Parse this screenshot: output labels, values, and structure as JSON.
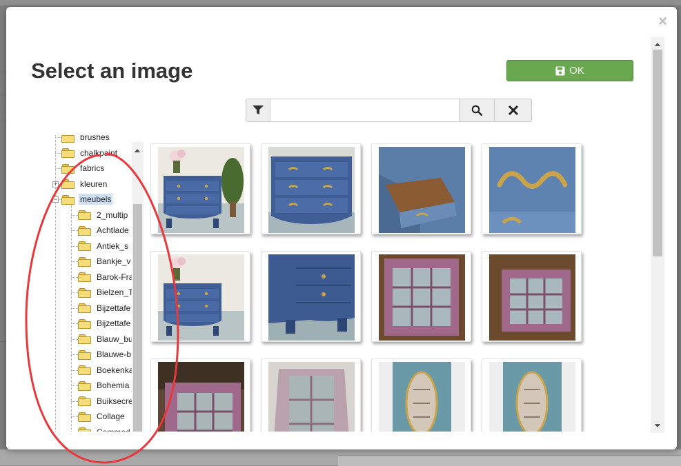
{
  "dialog": {
    "title": "Select an image",
    "close_label": "×",
    "ok_label": "OK",
    "ok_color": "#6aa84f"
  },
  "search": {
    "value": "",
    "placeholder": "",
    "filter_icon": "filter-icon",
    "search_icon": "search-icon",
    "clear_icon": "clear-icon"
  },
  "tree": {
    "items": [
      {
        "label": "brushes",
        "level": 1
      },
      {
        "label": "chalkpaint",
        "level": 1
      },
      {
        "label": "fabrics",
        "level": 1
      },
      {
        "label": "kleuren",
        "level": 1,
        "expander": "+"
      },
      {
        "label": "meubels",
        "level": 1,
        "expander": "−",
        "selected": true
      },
      {
        "label": "2_multip",
        "level": 2
      },
      {
        "label": "Achtlade",
        "level": 2
      },
      {
        "label": "Antiek_s",
        "level": 2
      },
      {
        "label": "Bankje_v",
        "level": 2
      },
      {
        "label": "Barok-Fra",
        "level": 2
      },
      {
        "label": "Bielzen_T",
        "level": 2
      },
      {
        "label": "Bijzettafe",
        "level": 2
      },
      {
        "label": "Bijzettafe",
        "level": 2
      },
      {
        "label": "Blauw_bu",
        "level": 2
      },
      {
        "label": "Blauwe-b",
        "level": 2
      },
      {
        "label": "Boekenka",
        "level": 2
      },
      {
        "label": "Bohemia",
        "level": 2
      },
      {
        "label": "Buiksecre",
        "level": 2
      },
      {
        "label": "Collage",
        "level": 2
      },
      {
        "label": "Commod",
        "level": 2
      }
    ]
  },
  "gallery": {
    "images": [
      {
        "name": "blue-commode-front-with-plant"
      },
      {
        "name": "blue-commode-drawers-closeup"
      },
      {
        "name": "blue-commode-open-drawer"
      },
      {
        "name": "gold-handle-closeup"
      },
      {
        "name": "blue-commode-front-with-flowers"
      },
      {
        "name": "blue-commode-side-view"
      },
      {
        "name": "pink-wall-cabinet-front"
      },
      {
        "name": "pink-wall-cabinet-angle"
      },
      {
        "name": "pink-wall-cabinet-side"
      },
      {
        "name": "pink-wall-cabinet-top"
      },
      {
        "name": "blue-oval-mirror-cabinet"
      },
      {
        "name": "blue-oval-mirror-cabinet-detail"
      }
    ]
  },
  "annotation": {
    "color": "#e8383b"
  }
}
